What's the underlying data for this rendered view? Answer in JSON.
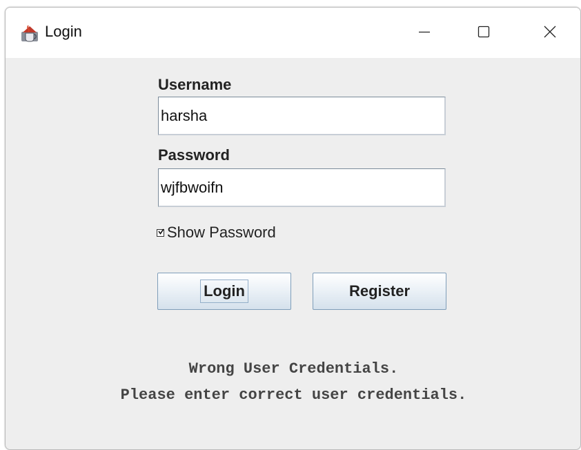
{
  "window": {
    "title": "Login",
    "icon": "java-cup-icon",
    "controls": {
      "minimize": "minimize-icon",
      "maximize": "maximize-icon",
      "close": "close-icon"
    }
  },
  "form": {
    "username_label": "Username",
    "username_value": "harsha",
    "password_label": "Password",
    "password_value": "wjfbwoifn",
    "show_password_label": "Show Password",
    "show_password_checked": true
  },
  "buttons": {
    "login_label": "Login",
    "register_label": "Register"
  },
  "message": {
    "line1": "Wrong User Credentials.",
    "line2": "Please enter correct user credentials."
  }
}
